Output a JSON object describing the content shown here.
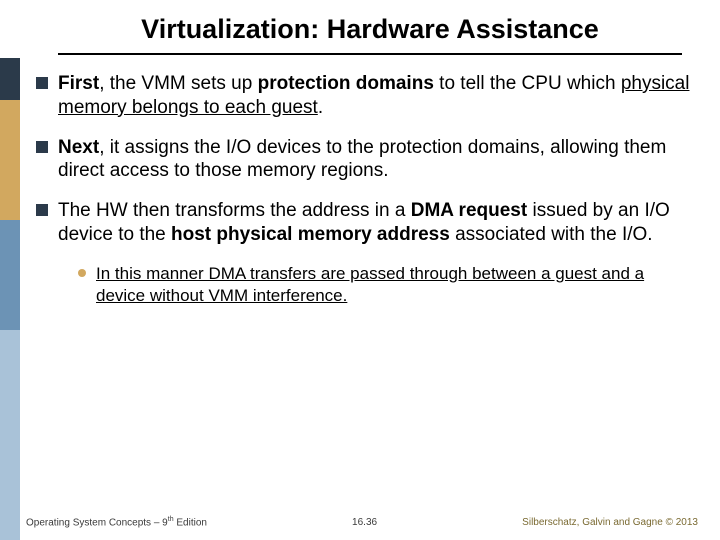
{
  "title": "Virtualization: Hardware Assistance",
  "bullets": {
    "b1": {
      "lead": "First",
      "phr1": "protection domains",
      "rest1": ", the VMM sets up ",
      "rest2": " to tell the CPU which ",
      "phr2": "physical memory belongs to each guest",
      "tail": "."
    },
    "b2": {
      "lead": "Next",
      "rest": ", it assigns the I/O devices to the protection domains, allowing them direct access to those memory regions."
    },
    "b3": {
      "p1": "The HW then transforms the address in a ",
      "phr1": "DMA request",
      "p2": " issued by an I/O device to the ",
      "phr2": "host physical memory address",
      "p3": " associated with the I/O."
    }
  },
  "sub": {
    "text": "In this manner DMA transfers are passed through between a guest and a device without VMM interference."
  },
  "footer": {
    "left_prefix": "Operating System Concepts – 9",
    "left_suffix": " Edition",
    "left_sup": "th",
    "center": "16.36",
    "right": "Silberschatz, Galvin and Gagne © 2013"
  }
}
